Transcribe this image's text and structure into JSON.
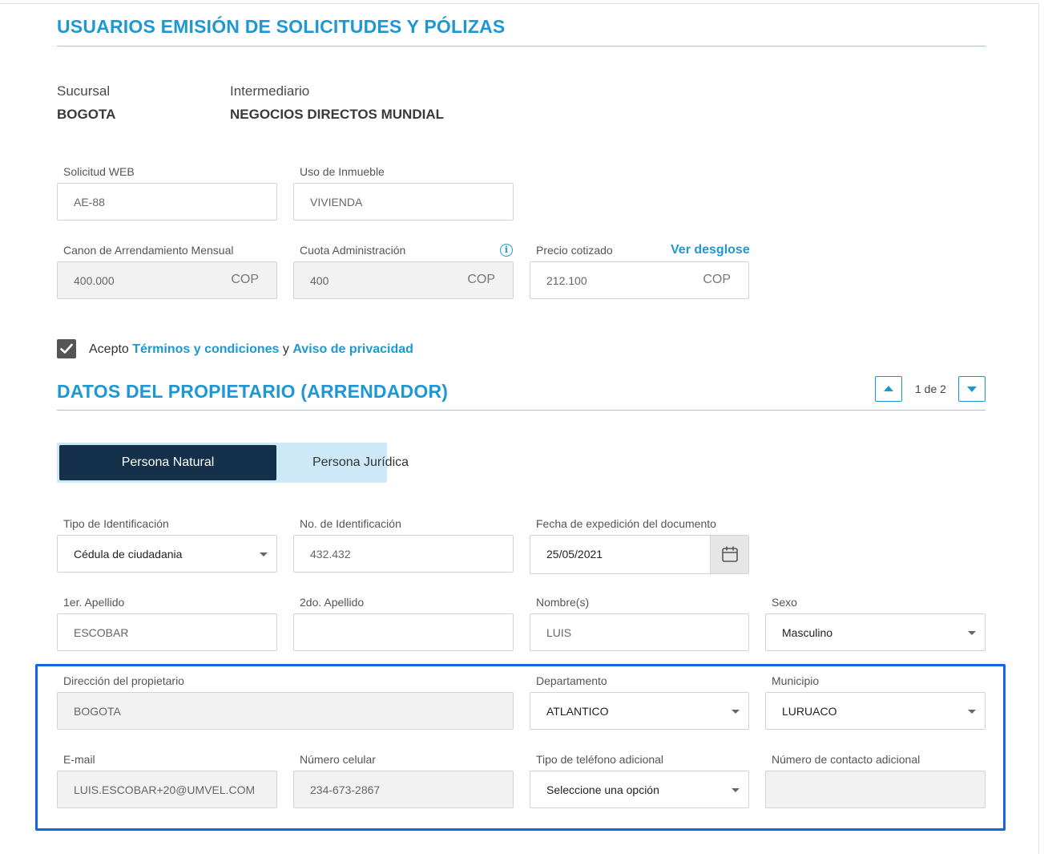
{
  "sections": {
    "users_title": "USUARIOS EMISIÓN DE SOLICITUDES Y PÓLIZAS",
    "owner_title": "DATOS DEL PROPIETARIO (ARRENDADOR)"
  },
  "info": {
    "sucursal_label": "Sucursal",
    "sucursal_value": "BOGOTA",
    "intermediario_label": "Intermediario",
    "intermediario_value": "NEGOCIOS DIRECTOS MUNDIAL"
  },
  "request": {
    "solicitud_web": {
      "label": "Solicitud WEB",
      "value": "AE-88"
    },
    "uso_inmueble": {
      "label": "Uso de Inmueble",
      "value": "VIVIENDA"
    },
    "canon": {
      "label": "Canon de Arrendamiento Mensual",
      "value": "400.000",
      "suffix": "COP"
    },
    "cuota_admin": {
      "label": "Cuota Administración",
      "value": "400",
      "suffix": "COP"
    },
    "precio": {
      "label": "Precio cotizado",
      "value": "212.100",
      "suffix": "COP",
      "link": "Ver desglose"
    }
  },
  "terms": {
    "prefix": "Acepto",
    "terms_link": "Términos y condiciones",
    "joiner": "y",
    "privacy_link": "Aviso de privacidad",
    "checked": true
  },
  "pager": {
    "text": "1 de 2"
  },
  "person_toggle": {
    "natural": "Persona Natural",
    "juridica": "Persona Jurídica",
    "selected": "natural"
  },
  "owner": {
    "tipo_id": {
      "label": "Tipo de Identificación",
      "value": "Cédula de ciudadania"
    },
    "no_id": {
      "label": "No. de Identificación",
      "value": "432.432"
    },
    "fecha_exp": {
      "label": "Fecha de expedición del documento",
      "value": "25/05/2021"
    },
    "apellido1": {
      "label": "1er. Apellido",
      "value": "ESCOBAR"
    },
    "apellido2": {
      "label": "2do. Apellido",
      "value": ""
    },
    "nombres": {
      "label": "Nombre(s)",
      "value": "LUIS"
    },
    "sexo": {
      "label": "Sexo",
      "value": "Masculino"
    },
    "direccion": {
      "label": "Dirección del propietario",
      "value": "BOGOTA"
    },
    "departamento": {
      "label": "Departamento",
      "value": "ATLANTICO"
    },
    "municipio": {
      "label": "Municipio",
      "value": "LURUACO"
    },
    "email": {
      "label": "E-mail",
      "value": "LUIS.ESCOBAR+20@UMVEL.COM"
    },
    "celular": {
      "label": "Número celular",
      "value": "234-673-2867"
    },
    "tipo_tel": {
      "label": "Tipo de teléfono adicional",
      "value": "Seleccione una opción"
    },
    "contacto_adicional": {
      "label": "Número de contacto adicional",
      "value": ""
    }
  },
  "colors": {
    "accent": "#1d98d4",
    "toggle_active": "#14304a",
    "highlight": "#1565e0"
  }
}
